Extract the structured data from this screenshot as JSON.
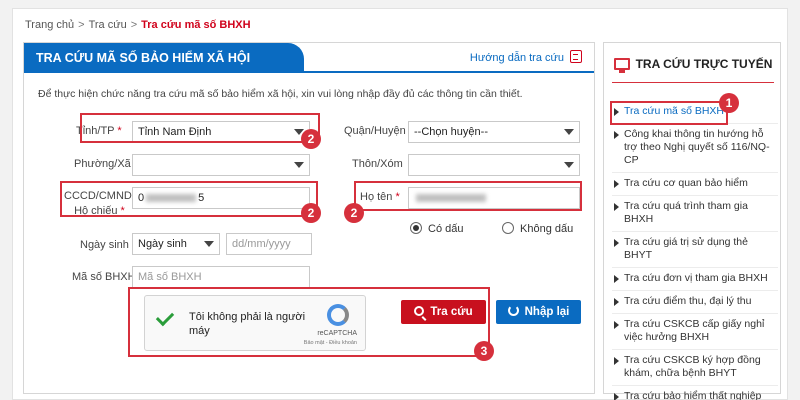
{
  "breadcrumb": {
    "home": "Trang chủ",
    "sep": ">",
    "parent": "Tra cứu",
    "current": "Tra cứu mã số BHXH"
  },
  "panel": {
    "title": "TRA CỨU MÃ SỐ BẢO HIỂM XÃ HỘI",
    "guide_link": "Hướng dẫn tra cứu",
    "intro": "Để thực hiện chức năng tra cứu mã số bảo hiểm xã hội, xin vui lòng nhập đầy đủ các thông tin cần thiết."
  },
  "form": {
    "province": {
      "label": "Tỉnh/TP",
      "required": "*",
      "value": "Tỉnh Nam Định"
    },
    "district": {
      "label": "Quận/Huyện",
      "value": "--Chọn huyện--"
    },
    "ward": {
      "label": "Phường/Xã",
      "value": ""
    },
    "hamlet": {
      "label": "Thôn/Xóm",
      "value": ""
    },
    "id_number": {
      "label_line1": "CCCD/CMND/",
      "label_line2": "Hộ chiếu",
      "required": "*",
      "value_start": "0",
      "value_end": "5"
    },
    "fullname": {
      "label": "Họ tên",
      "required": "*",
      "value": ""
    },
    "diacritics": {
      "with": "Có dấu",
      "without": "Không dấu"
    },
    "dob": {
      "label": "Ngày sinh",
      "type_value": "Ngày sinh",
      "placeholder": "dd/mm/yyyy"
    },
    "ssn": {
      "label": "Mã số BHXH",
      "placeholder": "Mã số BHXH"
    },
    "captcha": {
      "text": "Tôi không phải là người máy",
      "brand": "reCAPTCHA",
      "links": "Bảo mật - Điều khoản"
    },
    "search_button": "Tra cứu",
    "reset_button": "Nhập lại"
  },
  "badges": {
    "b1": "1",
    "b2": "2",
    "b3": "3"
  },
  "sidebar": {
    "title": "TRA CỨU TRỰC TUYẾN",
    "items": [
      {
        "label": "Tra cứu mã số BHXH"
      },
      {
        "label": "Công khai thông tin hướng hỗ trợ theo Nghị quyết số 116/NQ-CP"
      },
      {
        "label": "Tra cứu cơ quan bảo hiểm"
      },
      {
        "label": "Tra cứu quá trình tham gia BHXH"
      },
      {
        "label": "Tra cứu giá trị sử dụng thẻ BHYT"
      },
      {
        "label": "Tra cứu đơn vị tham gia BHXH"
      },
      {
        "label": "Tra cứu điểm thu, đại lý thu"
      },
      {
        "label": "Tra cứu CSKCB cấp giấy nghỉ việc hưởng BHXH"
      },
      {
        "label": "Tra cứu CSKCB ký hợp đồng khám, chữa bệnh BHYT"
      },
      {
        "label": "Tra cứu bảo hiểm thất nghiệp"
      }
    ]
  },
  "colors": {
    "primary": "#0a6bc1",
    "accent": "#c8101e",
    "highlight": "#d6303c"
  }
}
